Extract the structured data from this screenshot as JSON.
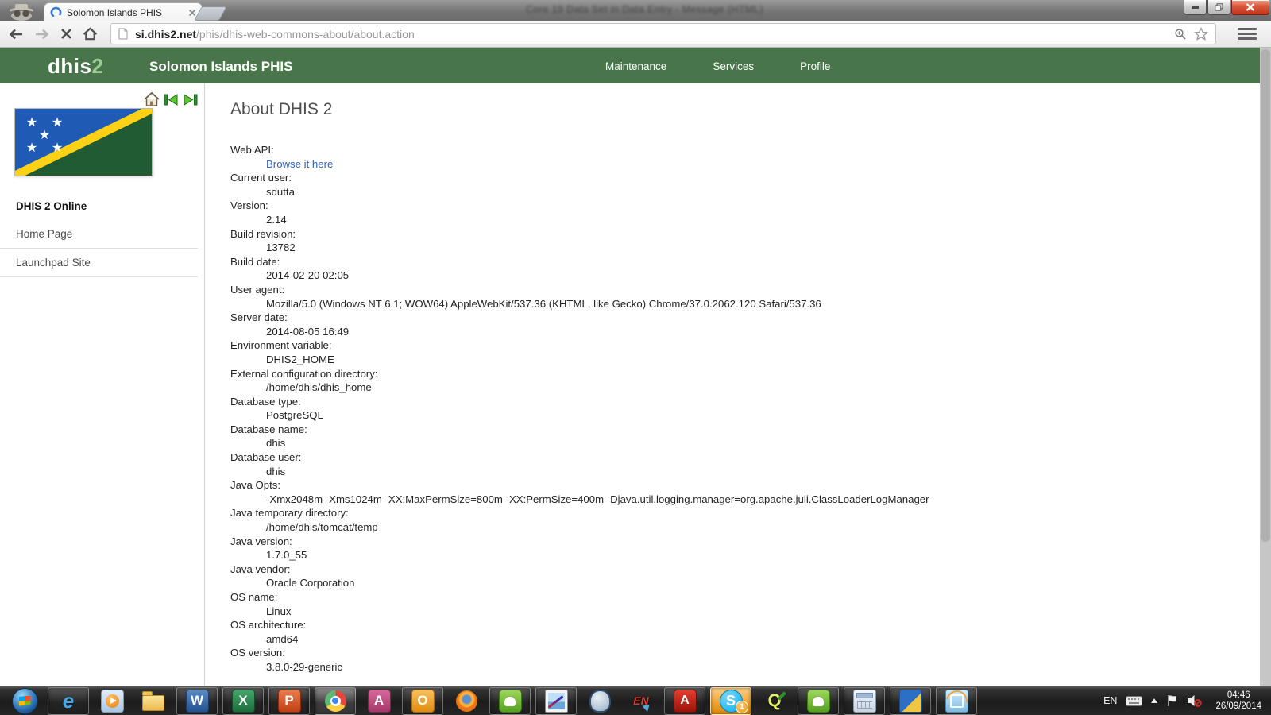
{
  "window": {
    "background_title": "Core 19 Data Set in Data Entry  -  Message (HTML)"
  },
  "browser": {
    "tab_title": "Solomon Islands PHIS",
    "url_host": "si.dhis2.net",
    "url_path": "/phis/dhis-web-commons-about/about.action"
  },
  "header": {
    "accent_color": "#48764a",
    "logo_text": "dhis",
    "logo_accent": "2",
    "site_title": "Solomon Islands PHIS",
    "nav": [
      {
        "id": "maintenance",
        "label": "Maintenance"
      },
      {
        "id": "services",
        "label": "Services"
      },
      {
        "id": "profile",
        "label": "Profile"
      }
    ]
  },
  "sidebar": {
    "section_title": "DHIS 2 Online",
    "links": [
      {
        "id": "home-page",
        "label": "Home Page"
      },
      {
        "id": "launchpad-site",
        "label": "Launchpad Site"
      }
    ]
  },
  "main": {
    "heading": "About DHIS 2",
    "link_color": "#3162c5",
    "items": [
      {
        "label": "Web API:",
        "value": "Browse it here",
        "link": true
      },
      {
        "label": "Current user:",
        "value": "sdutta"
      },
      {
        "label": "Version:",
        "value": "2.14"
      },
      {
        "label": "Build revision:",
        "value": "13782"
      },
      {
        "label": "Build date:",
        "value": "2014-02-20 02:05"
      },
      {
        "label": "User agent:",
        "value": "Mozilla/5.0 (Windows NT 6.1; WOW64) AppleWebKit/537.36 (KHTML, like Gecko) Chrome/37.0.2062.120 Safari/537.36"
      },
      {
        "label": "Server date:",
        "value": "2014-08-05 16:49"
      },
      {
        "label": "Environment variable:",
        "value": "DHIS2_HOME"
      },
      {
        "label": "External configuration directory:",
        "value": "/home/dhis/dhis_home"
      },
      {
        "label": "Database type:",
        "value": "PostgreSQL"
      },
      {
        "label": "Database name:",
        "value": "dhis"
      },
      {
        "label": "Database user:",
        "value": "dhis"
      },
      {
        "label": "Java Opts:",
        "value": "-Xmx2048m -Xms1024m -XX:MaxPermSize=800m -XX:PermSize=400m -Djava.util.logging.manager=org.apache.juli.ClassLoaderLogManager"
      },
      {
        "label": "Java temporary directory:",
        "value": "/home/dhis/tomcat/temp"
      },
      {
        "label": "Java version:",
        "value": "1.7.0_55"
      },
      {
        "label": "Java vendor:",
        "value": "Oracle Corporation"
      },
      {
        "label": "OS name:",
        "value": "Linux"
      },
      {
        "label": "OS architecture:",
        "value": "amd64"
      },
      {
        "label": "OS version:",
        "value": "3.8.0-29-generic"
      }
    ]
  },
  "taskbar": {
    "icons": [
      {
        "icon": "start",
        "name": "start-button"
      },
      {
        "icon": "ie",
        "name": "internet-explorer",
        "text": "e",
        "open": true
      },
      {
        "icon": "wmp",
        "name": "windows-media-player"
      },
      {
        "icon": "folder",
        "name": "windows-explorer"
      },
      {
        "icon": "word",
        "name": "ms-word",
        "text": "W",
        "open": true
      },
      {
        "icon": "excel",
        "name": "ms-excel",
        "text": "X",
        "open": true
      },
      {
        "icon": "ppt",
        "name": "ms-powerpoint",
        "text": "P",
        "open": true
      },
      {
        "icon": "chrome",
        "name": "google-chrome",
        "open": true,
        "active": true
      },
      {
        "icon": "access",
        "name": "ms-access",
        "text": "A"
      },
      {
        "icon": "outlook",
        "name": "ms-outlook",
        "text": "O",
        "open": true
      },
      {
        "icon": "firefox",
        "name": "firefox"
      },
      {
        "icon": "evernote",
        "name": "evernote",
        "open": true
      },
      {
        "icon": "photoviewer",
        "name": "photo-viewer",
        "open": true
      },
      {
        "icon": "postgres",
        "name": "postgresql"
      },
      {
        "icon": "endnote",
        "name": "endnote",
        "text": "EN"
      },
      {
        "icon": "adobe",
        "name": "adobe-reader",
        "text": "A",
        "open": true
      },
      {
        "icon": "skype",
        "name": "skype",
        "text": "S",
        "open": true,
        "attention": true,
        "badge": "1"
      },
      {
        "icon": "qgis",
        "name": "qgis",
        "text": "Q"
      },
      {
        "icon": "evernote",
        "name": "evernote-2",
        "open": true
      },
      {
        "icon": "calculator",
        "name": "calculator",
        "open": true
      },
      {
        "icon": "mediacenter",
        "name": "media-app",
        "open": true
      },
      {
        "icon": "defaultprograms",
        "name": "default-programs",
        "open": true
      }
    ],
    "tray": {
      "language": "EN",
      "time": "04:46",
      "date": "26/09/2014"
    }
  }
}
